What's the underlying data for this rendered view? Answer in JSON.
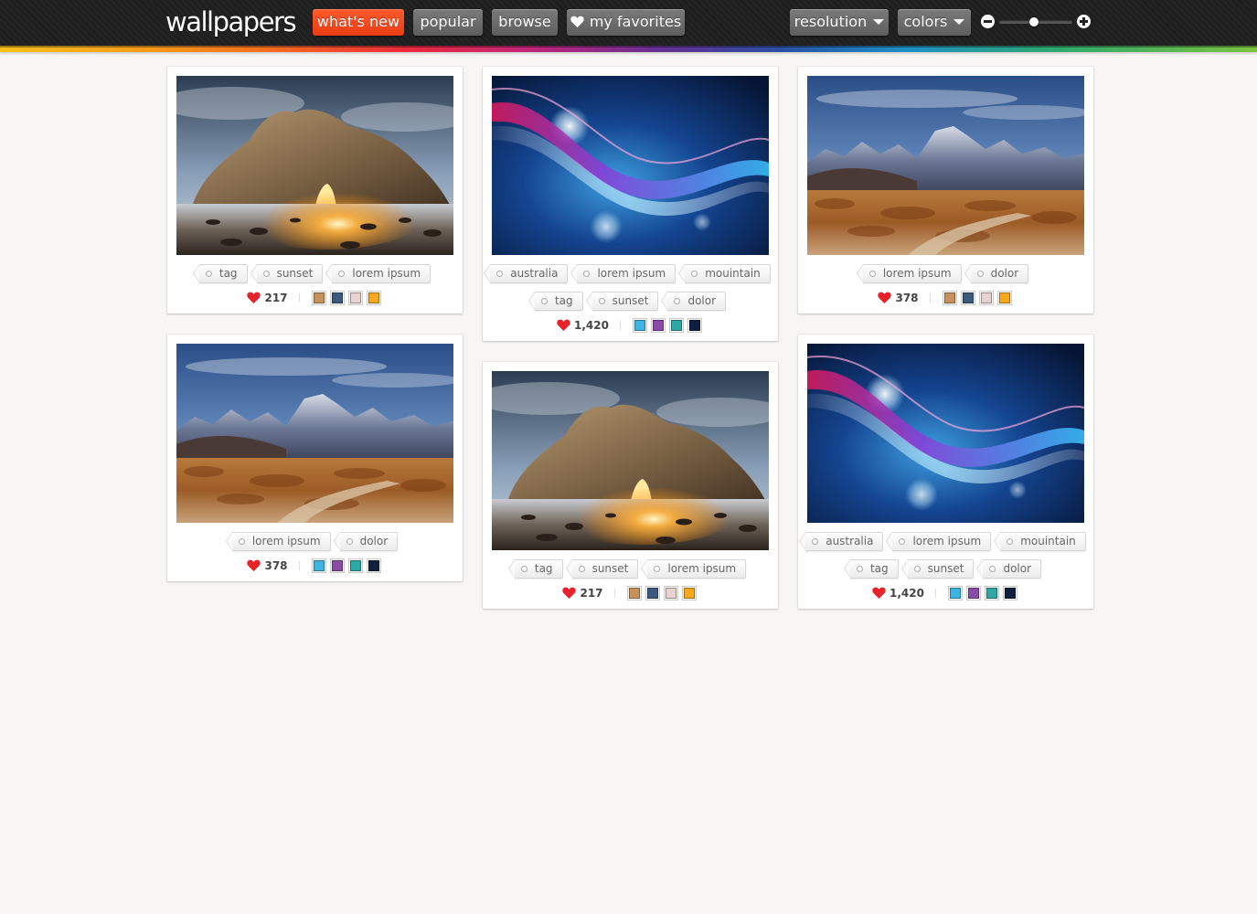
{
  "header": {
    "logo": "wallpapers",
    "nav": [
      {
        "label": "what's new",
        "active": true
      },
      {
        "label": "popular",
        "active": false
      },
      {
        "label": "browse",
        "active": false
      },
      {
        "label": "my favorites",
        "active": false,
        "icon": "heart-icon"
      }
    ],
    "filters": [
      {
        "label": "resolution",
        "icon": "caret-down-icon"
      },
      {
        "label": "colors",
        "icon": "caret-down-icon"
      }
    ],
    "zoom": {
      "minus_icon": "zoom-out-icon",
      "plus_icon": "zoom-in-icon",
      "level": 0.48
    },
    "accent": "#ee4a1b"
  },
  "cards": [
    {
      "image": "rock-arch-beach",
      "tags": [
        [
          "tag",
          "sunset",
          "lorem ipsum"
        ]
      ],
      "likes": "217",
      "colors": [
        "#c8905a",
        "#3c5a7e",
        "#e8d2d2",
        "#f7a81e"
      ]
    },
    {
      "image": "abstract-blue-wave",
      "tags": [
        [
          "australia",
          "lorem ipsum",
          "mouintain"
        ],
        [
          "tag",
          "sunset",
          "dolor"
        ]
      ],
      "likes": "1,420",
      "colors": [
        "#3fb4e3",
        "#8a4aa8",
        "#2ea8a6",
        "#10203e"
      ]
    },
    {
      "image": "desert-mountains",
      "tags": [
        [
          "lorem ipsum",
          "dolor"
        ]
      ],
      "likes": "378",
      "colors": [
        "#c8905a",
        "#3c5a7e",
        "#e8d2d2",
        "#f7a81e"
      ]
    },
    {
      "image": "desert-mountains",
      "tags": [
        [
          "lorem ipsum",
          "dolor"
        ]
      ],
      "likes": "378",
      "colors": [
        "#3fb4e3",
        "#8a4aa8",
        "#2ea8a6",
        "#10203e"
      ]
    },
    {
      "image": "rock-arch-beach",
      "tags": [
        [
          "tag",
          "sunset",
          "lorem ipsum"
        ]
      ],
      "likes": "217",
      "colors": [
        "#c8905a",
        "#3c5a7e",
        "#e8d2d2",
        "#f7a81e"
      ]
    },
    {
      "image": "abstract-blue-wave",
      "tags": [
        [
          "australia",
          "lorem ipsum",
          "mouintain"
        ],
        [
          "tag",
          "sunset",
          "dolor"
        ]
      ],
      "likes": "1,420",
      "colors": [
        "#3fb4e3",
        "#8a4aa8",
        "#2ea8a6",
        "#10203e"
      ]
    }
  ]
}
